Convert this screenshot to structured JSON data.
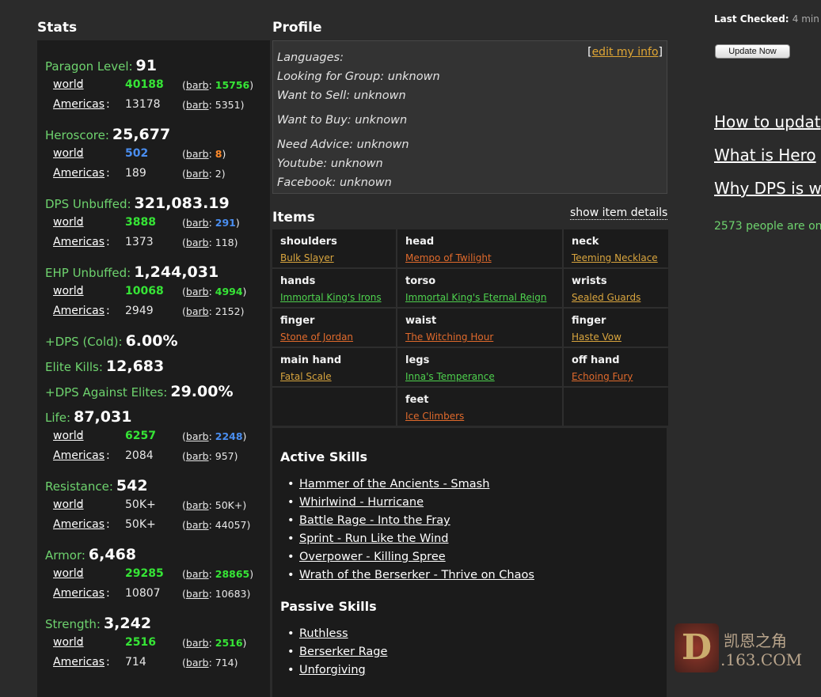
{
  "stats": {
    "title": "Stats",
    "paragon": {
      "label": "Paragon Level:",
      "value": "91",
      "world": {
        "label": "world",
        "value": "40188",
        "barb": "15756"
      },
      "region": {
        "label": "Americas",
        "value": "13178",
        "barb": "5351"
      }
    },
    "heroscore": {
      "label": "Heroscore:",
      "value": "25,677",
      "world": {
        "label": "world",
        "value": "502",
        "barb": "8"
      },
      "region": {
        "label": "Americas",
        "value": "189",
        "barb": "2"
      }
    },
    "dps": {
      "label": "DPS Unbuffed:",
      "value": "321,083.19",
      "world": {
        "label": "world",
        "value": "3888",
        "barb": "291"
      },
      "region": {
        "label": "Americas",
        "value": "1373",
        "barb": "118"
      }
    },
    "ehp": {
      "label": "EHP Unbuffed:",
      "value": "1,244,031",
      "world": {
        "label": "world",
        "value": "10068",
        "barb": "4994"
      },
      "region": {
        "label": "Americas",
        "value": "2949",
        "barb": "2152"
      }
    },
    "dps_cold": {
      "label": "+DPS (Cold):",
      "value": "6.00%"
    },
    "elite_kills": {
      "label": "Elite Kills:",
      "value": "12,683"
    },
    "dps_elites": {
      "label": "+DPS Against Elites:",
      "value": "29.00%"
    },
    "life": {
      "label": "Life:",
      "value": "87,031",
      "world": {
        "label": "world",
        "value": "6257",
        "barb": "2248"
      },
      "region": {
        "label": "Americas",
        "value": "2084",
        "barb": "957"
      }
    },
    "resistance": {
      "label": "Resistance:",
      "value": "542",
      "world": {
        "label": "world",
        "value": "50K+",
        "barb": "50K+"
      },
      "region": {
        "label": "Americas",
        "value": "50K+",
        "barb": "44057"
      }
    },
    "armor": {
      "label": "Armor:",
      "value": "6,468",
      "world": {
        "label": "world",
        "value": "29285",
        "barb": "28865"
      },
      "region": {
        "label": "Americas",
        "value": "10807",
        "barb": "10683"
      }
    },
    "strength": {
      "label": "Strength:",
      "value": "3,242",
      "world": {
        "label": "world",
        "value": "2516",
        "barb": "2516"
      },
      "region": {
        "label": "Americas",
        "value": "714",
        "barb": "714"
      }
    },
    "barb_label": "barb"
  },
  "profile": {
    "title": "Profile",
    "edit_link": "edit my info",
    "languages": "Languages:",
    "lfg": "Looking for Group: unknown",
    "wts": "Want to Sell: unknown",
    "wtb": "Want to Buy: unknown",
    "advice": "Need Advice: unknown",
    "youtube": "Youtube: unknown",
    "facebook": "Facebook: unknown"
  },
  "items": {
    "title": "Items",
    "show_details": "show item details",
    "cells": [
      {
        "slot": "shoulders",
        "name": "Bulk Slayer",
        "rarity": "legendary"
      },
      {
        "slot": "head",
        "name": "Mempo of Twilight",
        "rarity": "orange"
      },
      {
        "slot": "neck",
        "name": "Teeming Necklace",
        "rarity": "legendary"
      },
      {
        "slot": "hands",
        "name": "Immortal King's Irons",
        "rarity": "set"
      },
      {
        "slot": "torso",
        "name": "Immortal King's Eternal Reign",
        "rarity": "set"
      },
      {
        "slot": "wrists",
        "name": "Sealed Guards",
        "rarity": "legendary"
      },
      {
        "slot": "finger",
        "name": "Stone of Jordan",
        "rarity": "orange"
      },
      {
        "slot": "waist",
        "name": "The Witching Hour",
        "rarity": "orange"
      },
      {
        "slot": "finger",
        "name": "Haste Vow",
        "rarity": "legendary"
      },
      {
        "slot": "main hand",
        "name": "Fatal Scale",
        "rarity": "legendary"
      },
      {
        "slot": "legs",
        "name": "Inna's Temperance",
        "rarity": "set"
      },
      {
        "slot": "off hand",
        "name": "Echoing Fury",
        "rarity": "orange"
      },
      {
        "slot": "",
        "name": "",
        "rarity": ""
      },
      {
        "slot": "feet",
        "name": "Ice Climbers",
        "rarity": "orange"
      },
      {
        "slot": "",
        "name": "",
        "rarity": ""
      }
    ]
  },
  "skills": {
    "active_title": "Active Skills",
    "active": [
      "Hammer of the Ancients - Smash",
      "Whirlwind - Hurricane",
      "Battle Rage - Into the Fray",
      "Sprint - Run Like the Wind",
      "Overpower - Killing Spree",
      "Wrath of the Berserker - Thrive on Chaos"
    ],
    "passive_title": "Passive Skills",
    "passive": [
      "Ruthless",
      "Berserker Rage",
      "Unforgiving"
    ]
  },
  "sidebar": {
    "last_checked_label": "Last Checked:",
    "last_checked_value": "4 min",
    "update_button": "Update Now",
    "link1": "How to updat",
    "link2": "What is Hero",
    "link3": "Why DPS is w",
    "online": "2573 people are on"
  },
  "watermark": {
    "d": "D",
    "cn": "凯恩之角",
    "site": ".163.COM"
  },
  "colors": {
    "set": "#4ed24e",
    "legendary": "#d9a53e",
    "unique_orange": "#e06a2c",
    "stat_green": "#6ed36e",
    "highlight_blue": "#4a8ef0"
  }
}
